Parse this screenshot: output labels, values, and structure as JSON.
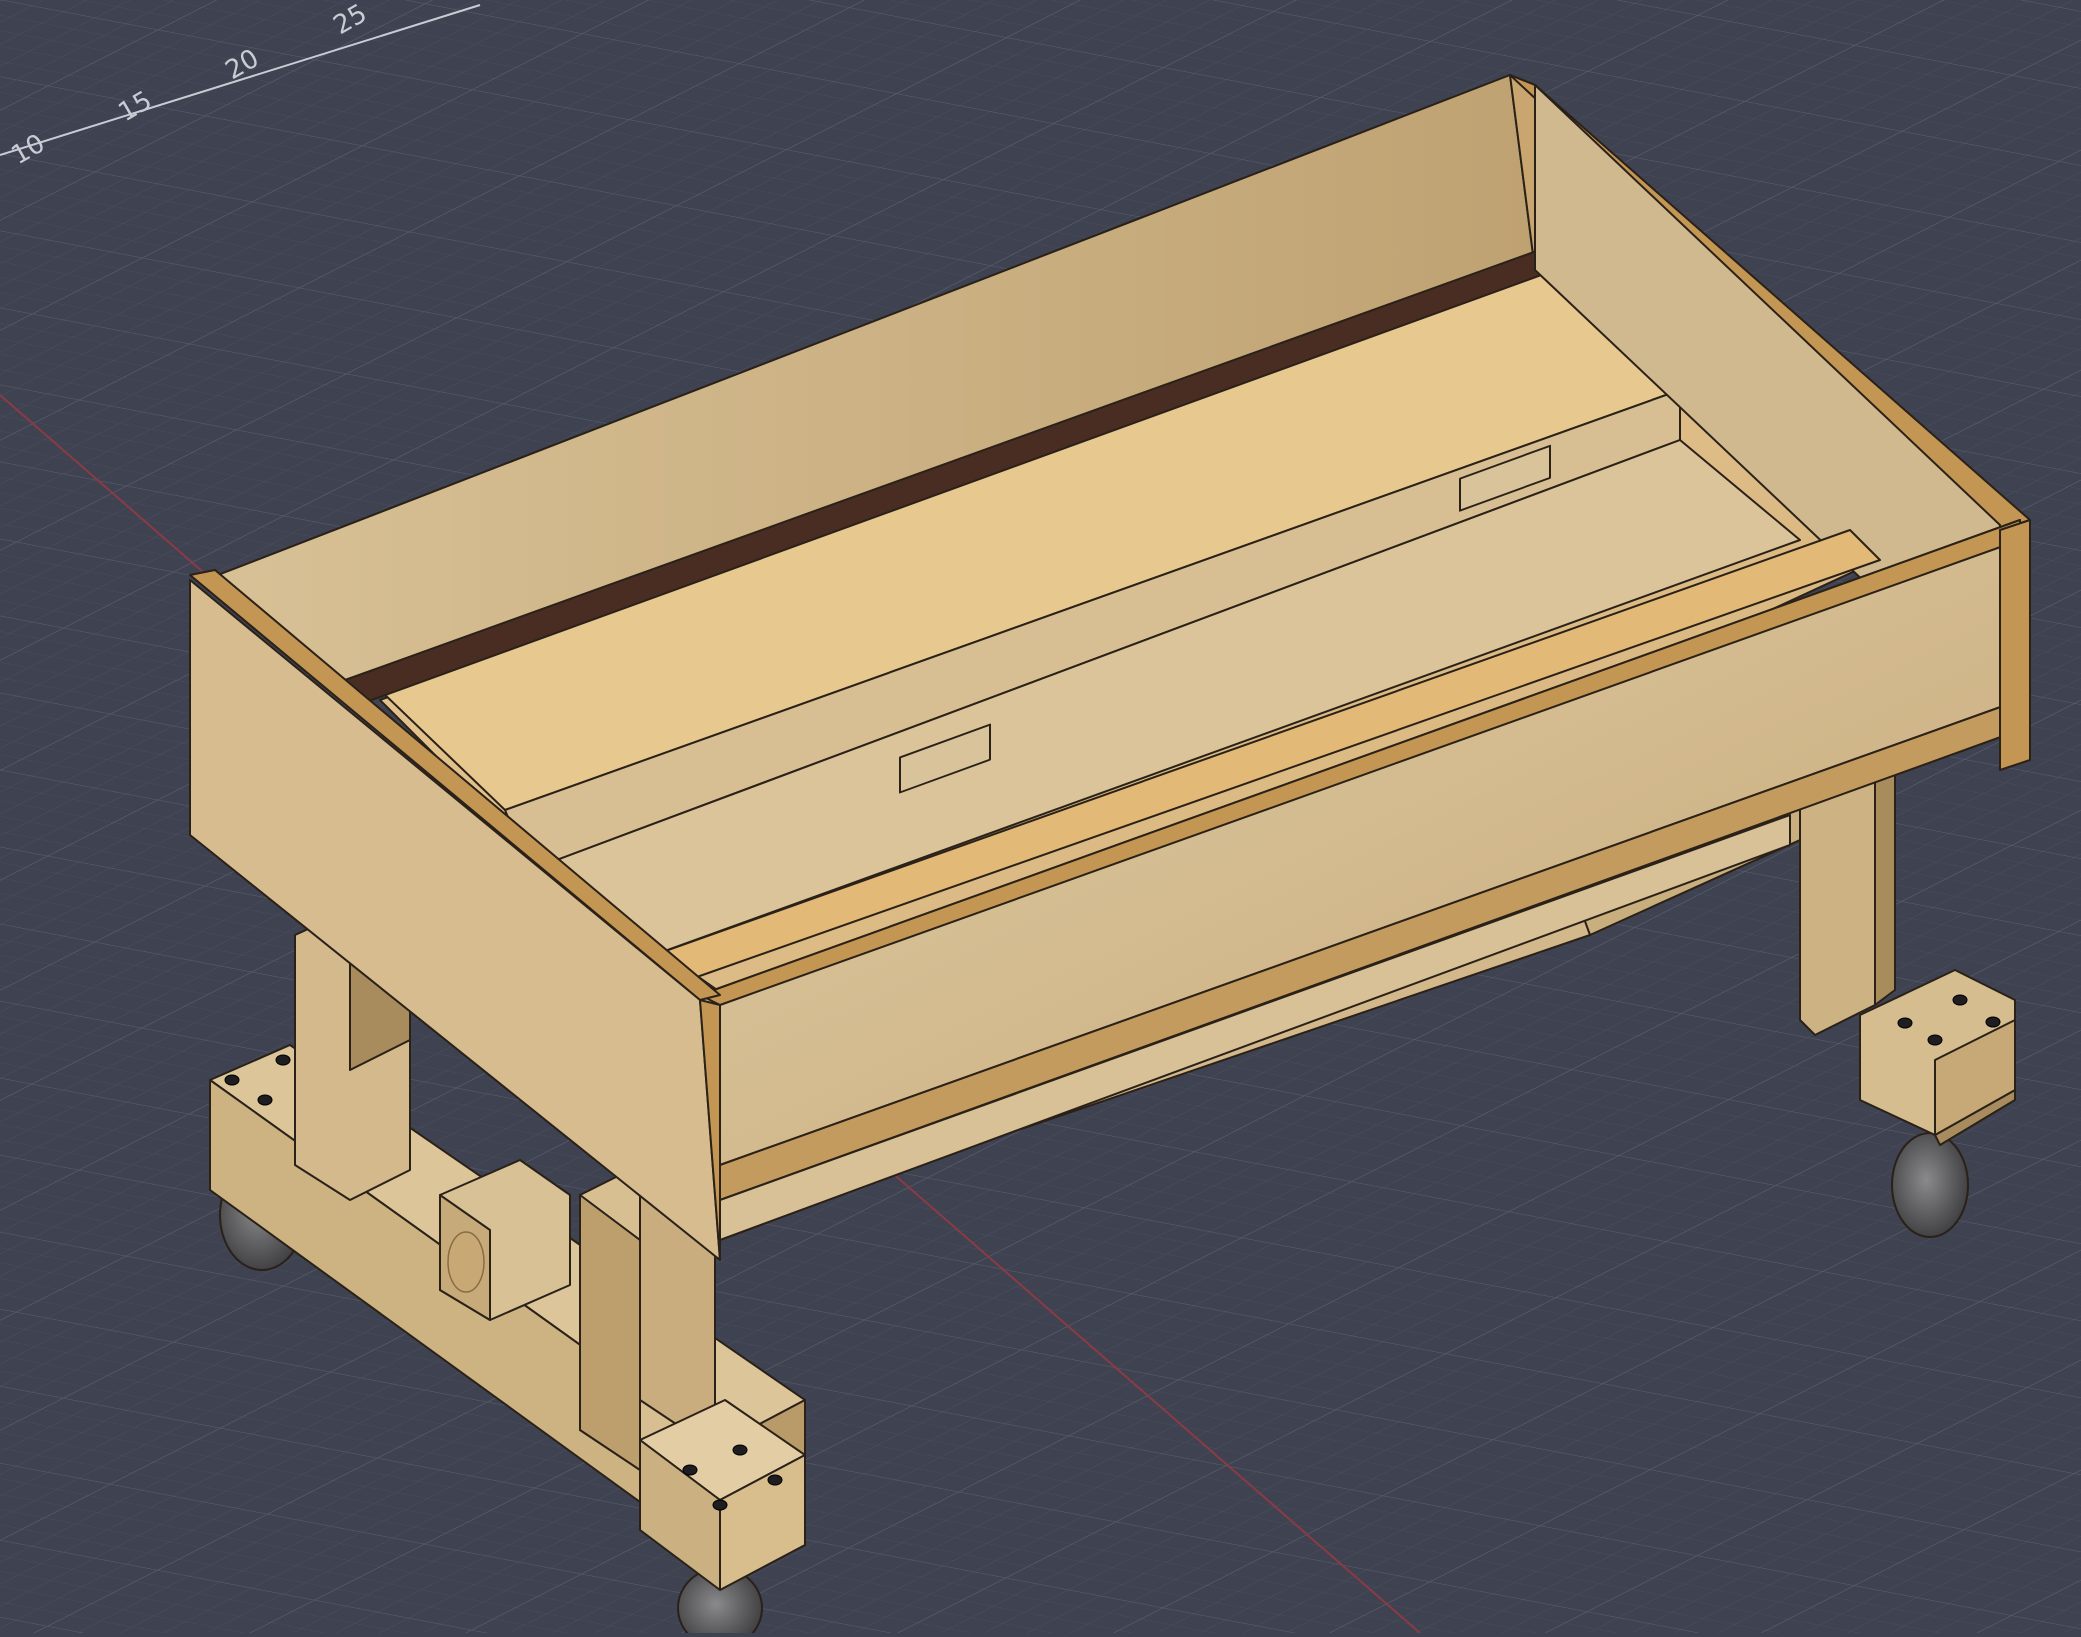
{
  "viewport": {
    "background_color": "#3f4250",
    "grid_color_minor": "#4a4e5c",
    "grid_color_major": "#5a5f6e",
    "axis_color": "#8c3a44",
    "ruler_labels": [
      "10",
      "15",
      "20",
      "25"
    ]
  },
  "model": {
    "wood_light": "#d9c39b",
    "wood_mid": "#c9ad7c",
    "wood_dark": "#a88c5d",
    "edge_color": "#c49653",
    "strip_color": "#4a2d22",
    "caster_color": "#5a5a5c"
  }
}
